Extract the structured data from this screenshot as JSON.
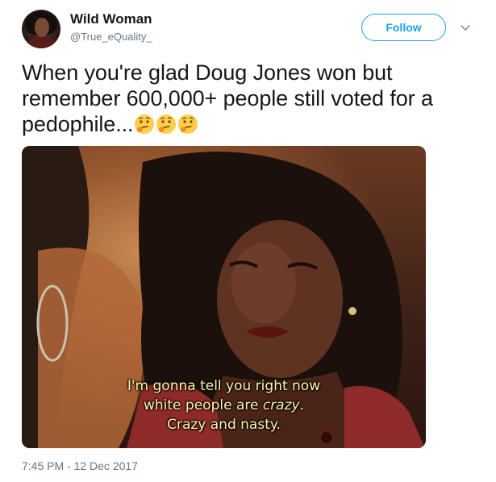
{
  "user": {
    "display_name": "Wild Woman",
    "screen_name": "@True_eQuality_"
  },
  "actions": {
    "follow_label": "Follow",
    "more_icon": "chevron-down-icon"
  },
  "tweet": {
    "text": "When you're glad Doug Jones won but remember 600,000+ people still voted for a pedophile...",
    "emoji": [
      "thinking-face-emoji",
      "thinking-face-emoji",
      "thinking-face-emoji"
    ],
    "timestamp": "7:45 PM - 12 Dec 2017"
  },
  "media": {
    "subtitle_line1": "I'm gonna tell you right now",
    "subtitle_line2_prefix": "white people are ",
    "subtitle_line2_emph": "crazy",
    "subtitle_line2_suffix": ".",
    "subtitle_line3": "Crazy and nasty."
  },
  "colors": {
    "accent": "#1da1f2",
    "secondary_text": "#657786",
    "subtitle": "#fdf6a8"
  }
}
